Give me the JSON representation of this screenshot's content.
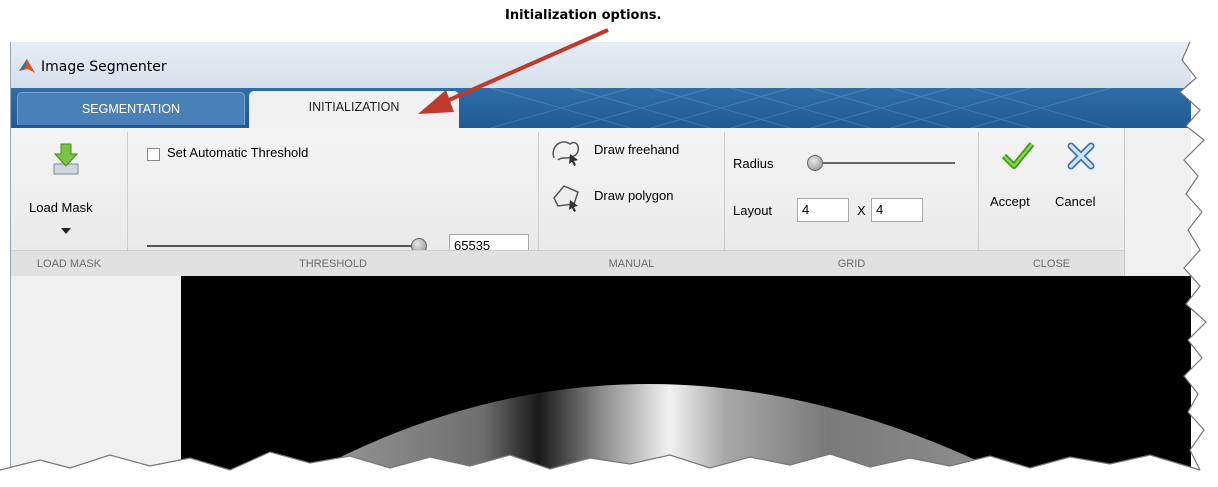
{
  "callout": {
    "text": "Initialization options."
  },
  "window": {
    "title": "Image Segmenter"
  },
  "tabs": [
    {
      "label": "SEGMENTATION",
      "active": false
    },
    {
      "label": "INITIALIZATION",
      "active": true
    }
  ],
  "load_mask": {
    "button_label": "Load Mask",
    "section_label": "LOAD MASK"
  },
  "threshold": {
    "checkbox_label": "Set Automatic Threshold",
    "checked": false,
    "value": "65535",
    "slider_level": 1.0,
    "section_label": "THRESHOLD"
  },
  "manual": {
    "draw_freehand": "Draw freehand",
    "draw_polygon": "Draw polygon",
    "section_label": "MANUAL"
  },
  "grid": {
    "radius_label": "Radius",
    "radius_level": 0.0,
    "layout_label": "Layout",
    "layout_rows": "4",
    "layout_sep": "X",
    "layout_cols": "4",
    "section_label": "GRID"
  },
  "close": {
    "accept_label": "Accept",
    "cancel_label": "Cancel",
    "section_label": "CLOSE"
  },
  "colors": {
    "tab_strip": "#1f5a94",
    "accept": "#4caf1a",
    "cancel": "#6aa3d8",
    "arrow": "#c0392b"
  }
}
